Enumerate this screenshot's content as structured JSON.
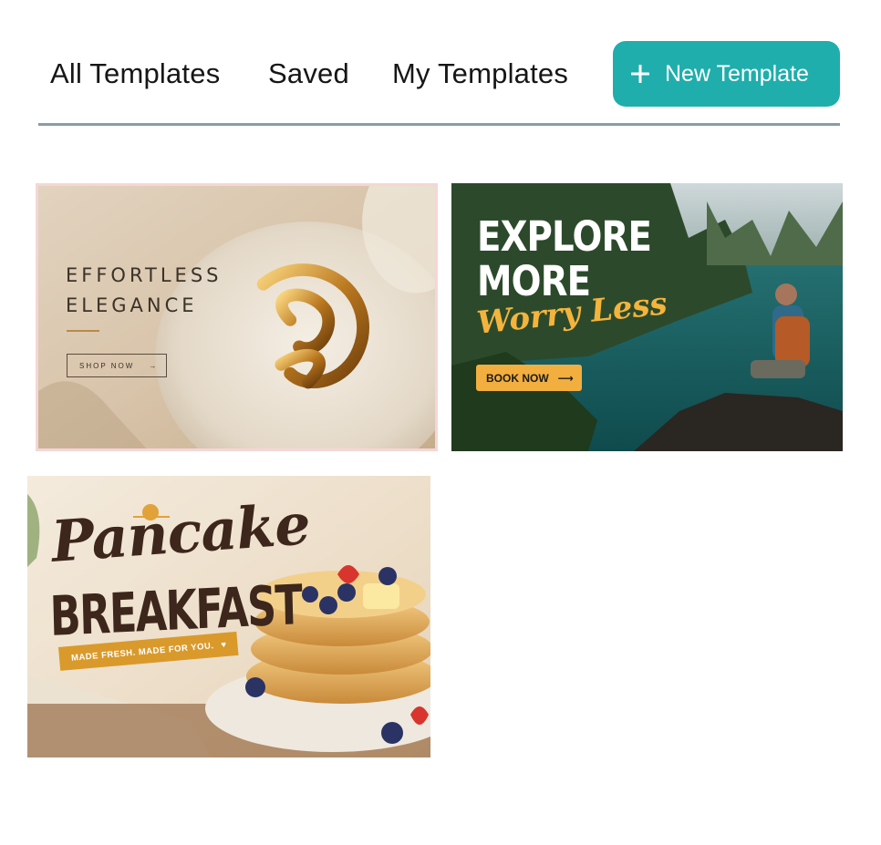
{
  "tabs": [
    {
      "label": "All Templates"
    },
    {
      "label": "Saved"
    },
    {
      "label": "My Templates"
    }
  ],
  "new_template_button": {
    "label": "New Template",
    "icon": "plus-icon",
    "color": "#1faeac"
  },
  "templates": [
    {
      "title": "EFFORTLESS\nELEGANCE",
      "button": "SHOP NOW",
      "selected": true
    },
    {
      "title": "EXPLORE\nMORE",
      "subtitle": "Worry Less",
      "button": "BOOK NOW"
    },
    {
      "script": "Pancake",
      "title": "BREAKFAST",
      "tagline": "MADE FRESH. MADE FOR YOU."
    }
  ],
  "colors": {
    "tab_underline": "#8a9ba8",
    "selected_border": "#f5d6d7"
  }
}
